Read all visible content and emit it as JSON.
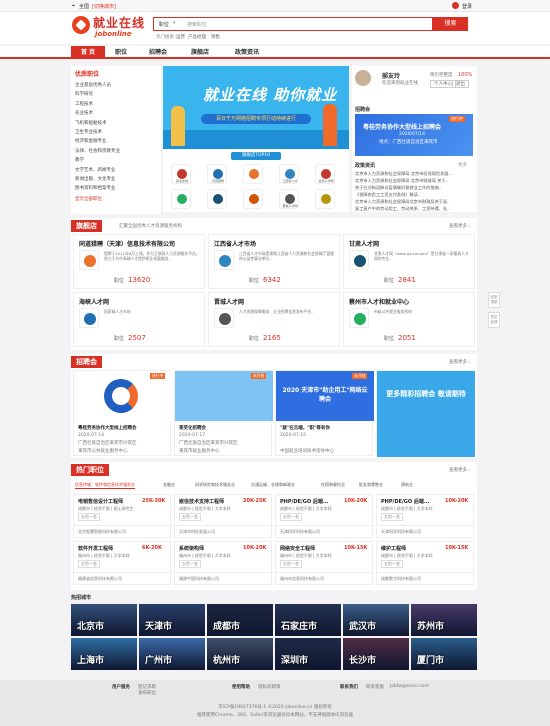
{
  "topbar": {
    "location": "全国",
    "switch": "[切换城市]",
    "user": "登录"
  },
  "header": {
    "brand": "就业在线",
    "brand_en": "jobonline",
    "search_type": "职位",
    "search_placeholder": "搜索职位",
    "search_btn": "搜索",
    "hot_label": "热门搜索：",
    "hot_terms": [
      "运营",
      "产品经理",
      "销售"
    ]
  },
  "nav": [
    "首 页",
    "职位",
    "招聘会",
    "旗舰店",
    "政策资讯"
  ],
  "sidebar": {
    "title": "优质职位",
    "items": [
      "企业基层优秀人员",
      "科学研究",
      "工程技术",
      "农业技术",
      "飞机和船舶技术",
      "卫生专业技术",
      "经济和金融专业",
      "法律、社会和宗教专业",
      "教学",
      "文学艺术、新闻专业",
      "新闻出版、文化专业",
      "图书资料和档案专业"
    ],
    "more": "显示全部职位"
  },
  "banner": {
    "title": "就业在线 助你就业",
    "sub": "百日千万网络招聘专项行动持续进行"
  },
  "hotlogos": {
    "title": "旗舰店TOP10",
    "names": [
      "就业在线",
      "同道猎聘",
      "",
      "江西省人才",
      "甘肃人才网",
      "",
      "",
      "",
      "晋城人才网",
      ""
    ]
  },
  "user": {
    "name": "郝友玲",
    "greeting": "欢迎来到就业在线",
    "resume_label": "简历完整度",
    "resume_pct": "100%",
    "action1": "个人中心",
    "action2": "退出"
  },
  "jobfair_promo": {
    "label": "招聘会",
    "title": "粤桂劳务协作大型线上招聘会",
    "date": "2020/07/14",
    "place": "地点：广西壮族自治区来宾市",
    "badge": "进行中"
  },
  "policy": {
    "title": "政策资讯",
    "more": "更多",
    "lines": [
      "北京市人力资源和社会保障局 北京市医保保险发展..",
      "北京市人力资源和社会保障局 北京市财政局 关于..",
      "关于应对新冠肺炎疫情做好稳就业工作的措施..",
      "《保障农民工工资支付条例》解读..",
      "北京市人力资源和社会保障局北京市财政局关于延..",
      "复工复产中的劳动用工、劳动关系、工资待遇、社.."
    ]
  },
  "flagship": {
    "label": "旗舰店",
    "subtitle": "汇聚全国优秀人才资源服务机构",
    "more": "查看更多 ›",
    "job_label": "职位",
    "items": [
      {
        "name": "同道猎聘（天津）信息技术有限公司",
        "desc": "猎聘于2011年6月上线。作为互联网人力资源服务平台，致力于为中高端人才提供职业发展服务..",
        "count": "13620"
      },
      {
        "name": "江西省人才市场",
        "desc": "江西省人才市场是隶属江西省人力资源和社会保障厅管理的公益性事业单位..",
        "count": "6342"
      },
      {
        "name": "甘肃人才网",
        "desc": "甘肃人才网（www.gsrcw.com）是甘肃省一家最具人才网的专业..",
        "count": "2841"
      },
      {
        "name": "海峡人才网",
        "desc": "国家级人才市场",
        "count": "2507"
      },
      {
        "name": "晋城人才网",
        "desc": "人才资源保障服务、企业招聘信息发布平台..",
        "count": "2165"
      },
      {
        "name": "蔡州市人才和就业中心",
        "desc": "市级公共就业服务机构",
        "count": "2051"
      }
    ]
  },
  "jobfairs": {
    "label": "招聘会",
    "more": "查看更多 ›",
    "items": [
      {
        "title": "粤桂劳务协作大型线上招聘会",
        "date": "2020-07-14",
        "place": "广西壮族自治区来宾市兴宾区",
        "badge": "进行中",
        "host": "来宾市公共就业服务中心"
      },
      {
        "title": "莱芜化招聘会",
        "date": "2020-07-17",
        "place": "广西壮族自治区来宾市兴宾区",
        "badge": "未开始",
        "host": "来宾市就业服务中心"
      },
      {
        "title": "\"就\"在云端，\"职\"等有你",
        "date": "2020-07-15",
        "place": "",
        "badge": "未开始",
        "host": "中国就业培训技术指导中心"
      },
      {
        "title": "更多精彩招聘会 敬请期待",
        "date": "",
        "place": "",
        "badge": "",
        "host": ""
      }
    ],
    "posters": [
      "2020 天津市\"助企用工\"网络云聘会",
      "更多精彩招聘会 敬请期待"
    ]
  },
  "hotjobs": {
    "label": "热门职位",
    "more": "查看更多 ›",
    "tabs": [
      "信息传输、软件和信息技术服务业",
      "金融业",
      "科学研究和技术服务业",
      "交通运输、仓储和邮政业",
      "住宿和餐饮业",
      "批发和零售业",
      "建筑业"
    ],
    "items": [
      {
        "title": "电销售信设计工程师",
        "salary": "25K-30K",
        "info": "成都市 | 经验不限 | 硕士研究生",
        "tag": "五险一金",
        "company": "北京智慧智能科技有限公司"
      },
      {
        "title": "嵌信技术支持工程师",
        "salary": "20K-25K",
        "info": "成都市 | 经验不限 | 大学本科",
        "tag": "五险一金",
        "company": "天津市科技发展公司"
      },
      {
        "title": "PHP/DE/GO 后端...",
        "salary": "10K-20K",
        "info": "成都市 | 经验不限 | 大学本科",
        "tag": "五险一金",
        "company": "天津科学科技有限公司"
      },
      {
        "title": "PHP/DE/GO 后端...",
        "salary": "10K-20K",
        "info": "成都市 | 经验不限 | 大学本科",
        "tag": "五险一金",
        "company": "天津科学科技有限公司"
      },
      {
        "title": "软件开发工程师",
        "salary": "6K-20K",
        "info": "福州市 | 经验不限 | 大学本科",
        "tag": "五险一金",
        "company": "福建省信息科技有限公司"
      },
      {
        "title": "系统架构师",
        "salary": "10K-20K",
        "info": "福州市 | 经验不限 | 大学本科",
        "tag": "五险一金",
        "company": "福建中国科技有限公司"
      },
      {
        "title": "网络安全工程师",
        "salary": "10K-15K",
        "info": "福州市 | 经验不限 | 大学本科",
        "tag": "五险一金",
        "company": "福州市信息科技有限公司"
      },
      {
        "title": "维护工程师",
        "salary": "10K-15K",
        "info": "成都市 | 经验不限 | 大学本科",
        "tag": "五险一金",
        "company": "成都数字科技有限公司"
      }
    ]
  },
  "cities": {
    "title": "热招城市",
    "items": [
      "北京市",
      "天津市",
      "成都市",
      "石家庄市",
      "武汉市",
      "苏州市",
      "上海市",
      "广州市",
      "杭州市",
      "深圳市",
      "长沙市",
      "厦门市"
    ]
  },
  "footer": {
    "col1": [
      "用户服务",
      "登记求职",
      "发布职位"
    ],
    "col2": [
      "使用帮助",
      "隐私权政策"
    ],
    "col3": [
      "联系我们",
      "联系客服",
      "jobfw@osscr.com"
    ],
    "copy1": "京ICP备19037376号-1  ©2020 jobonline.cn 版权所有",
    "copy2": "推荐使用Chrome、360、Safari等浏览器访问本网站，不支持低版本IE浏览器"
  },
  "float": [
    "回到顶部",
    "意见反馈"
  ],
  "colors": {
    "accent": "#d93025",
    "banner": "#39b4ec"
  }
}
